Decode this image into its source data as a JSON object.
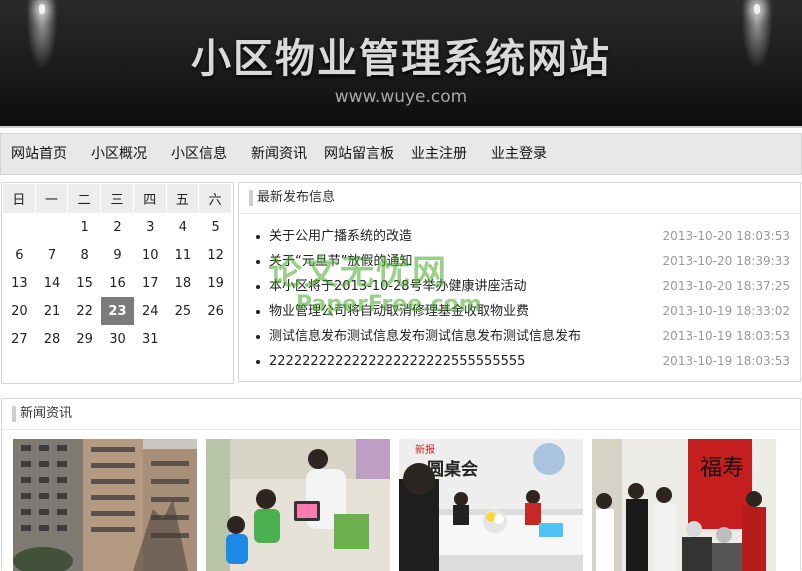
{
  "banner": {
    "title": "小区物业管理系统网站",
    "url": "www.wuye.com"
  },
  "nav": {
    "items": [
      "网站首页",
      "小区概况",
      "小区信息",
      "新闻资讯",
      "网站留言板",
      "业主注册",
      "业主登录"
    ]
  },
  "calendar": {
    "weekdays": [
      "日",
      "一",
      "二",
      "三",
      "四",
      "五",
      "六"
    ],
    "weeks": [
      [
        "",
        "",
        "1",
        "2",
        "3",
        "4",
        "5"
      ],
      [
        "6",
        "7",
        "8",
        "9",
        "10",
        "11",
        "12"
      ],
      [
        "13",
        "14",
        "15",
        "16",
        "17",
        "18",
        "19"
      ],
      [
        "20",
        "21",
        "22",
        "23",
        "24",
        "25",
        "26"
      ],
      [
        "27",
        "28",
        "29",
        "30",
        "31",
        "",
        ""
      ]
    ],
    "today": "23"
  },
  "latest": {
    "heading": "最新发布信息",
    "items": [
      {
        "title": "关于公用广播系统的改造",
        "date": "2013-10-20 18:03:53"
      },
      {
        "title": "关于“元旦节”放假的通知",
        "date": "2013-10-20 18:39:33"
      },
      {
        "title": "本小区将于2013-10-28号举办健康讲座活动",
        "date": "2013-10-20 18:37:25"
      },
      {
        "title": "物业管理公司将自动取消修理基金收取物业费",
        "date": "2013-10-19 18:33:02"
      },
      {
        "title": "测试信息发布测试信息发布测试信息发布测试信息发布",
        "date": "2013-10-19 18:03:53"
      },
      {
        "title": "2222222222222222222222555555555",
        "date": "2013-10-19 18:03:53"
      }
    ]
  },
  "news": {
    "heading": "新闻资讯",
    "photos": [
      "building-photo",
      "children-photo",
      "meeting-photo",
      "elderly-visit-photo"
    ]
  },
  "photo_captions": {
    "meeting_sign": "圆桌会",
    "meeting_brand": "新报",
    "visit_banner": "福寿"
  },
  "watermark": {
    "line1": "论文无忧网",
    "line2": "PaperFree.com"
  },
  "colors": {
    "banner_bg": "#1b1b1b",
    "nav_bg": "#e8e8e8",
    "today_bg": "#7b7b7b",
    "date_text": "#999999"
  }
}
